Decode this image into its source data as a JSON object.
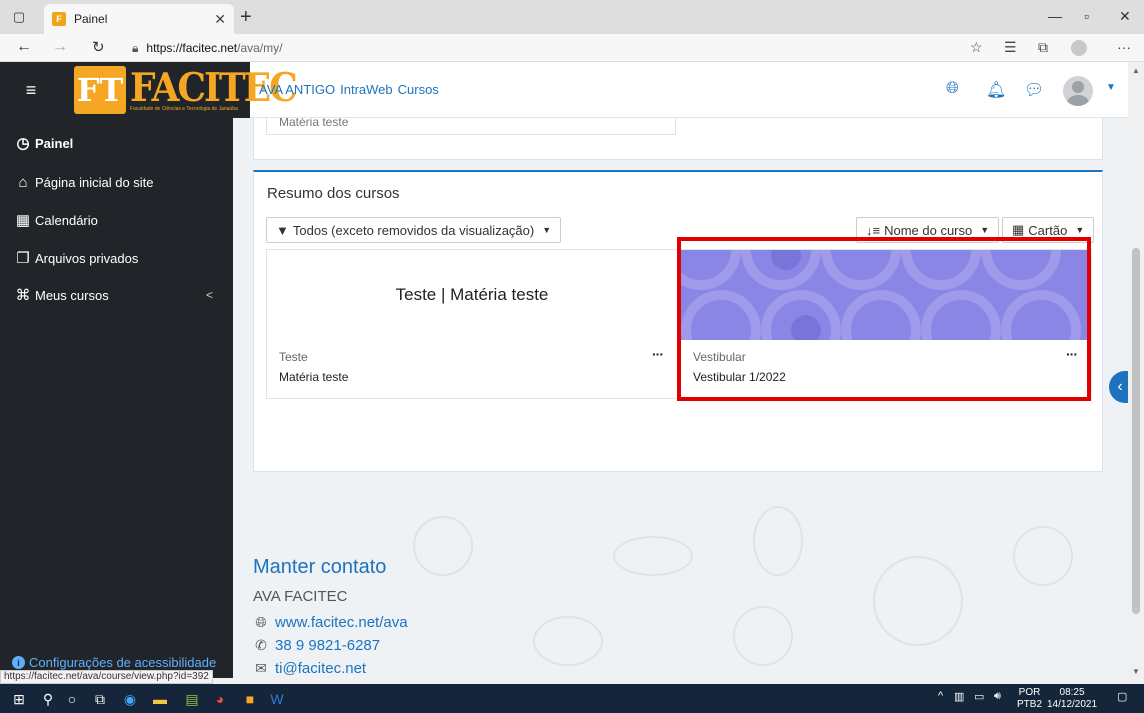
{
  "browser": {
    "tab_title": "Painel",
    "url_domain": "https://facitec.net",
    "url_path": "/ava/my/",
    "status_url": "https://facitec.net/ava/course/view.php?id=392"
  },
  "navbar": {
    "logo_text": "FACITEC",
    "logo_mark": "FT",
    "logo_tagline": "Faculdade de Ciências e Tecnologia de Janaúba",
    "links": [
      "AVA ANTIGO",
      "IntraWeb",
      "Cursos"
    ]
  },
  "sidebar": {
    "items": [
      {
        "label": "Painel",
        "icon": "gauge-icon"
      },
      {
        "label": "Página inicial do site",
        "icon": "home-icon"
      },
      {
        "label": "Calendário",
        "icon": "calendar-icon"
      },
      {
        "label": "Arquivos privados",
        "icon": "files-icon"
      },
      {
        "label": "Meus cursos",
        "icon": "graduation-cap-icon"
      }
    ],
    "accessibility": "Configurações de acessibilidade"
  },
  "main": {
    "prev_card_text": "Matéria teste",
    "resumo_title": "Resumo dos cursos",
    "filter_label": "Todos (exceto removidos da visualização)",
    "sort_label": "Nome do curso",
    "view_label": "Cartão",
    "courses": [
      {
        "image_title": "Teste | Matéria teste",
        "category": "Teste",
        "name": "Matéria teste",
        "menu": "···"
      },
      {
        "image_title": "",
        "category": "Vestibular",
        "name": "Vestibular 1/2022",
        "menu": "···"
      }
    ]
  },
  "footer": {
    "title": "Manter contato",
    "org": "AVA FACITEC",
    "website": "www.facitec.net/ava",
    "phone": "38 9 9821-6287",
    "email": "ti@facitec.net"
  },
  "taskbar": {
    "lang_top": "POR",
    "lang_bottom": "PTB2",
    "time": "08:25",
    "date": "14/12/2021"
  },
  "colors": {
    "accent": "#1e73be",
    "sidebar_bg": "#212529",
    "highlight": "#e00000",
    "logo": "#f5a623"
  }
}
